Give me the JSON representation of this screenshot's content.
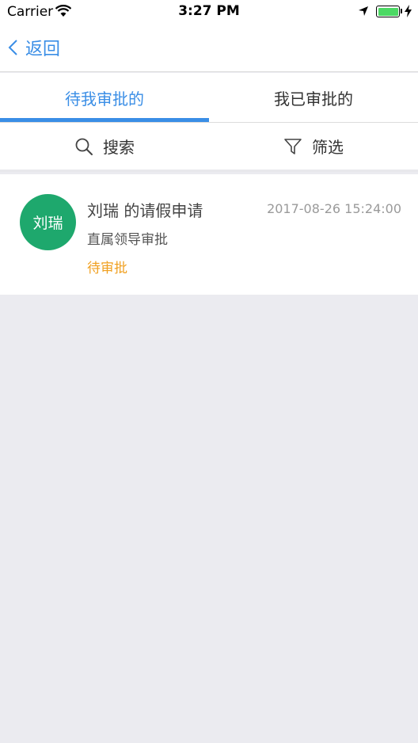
{
  "status_bar": {
    "carrier": "Carrier",
    "time": "3:27 PM",
    "icons": [
      "wifi-icon",
      "location-arrow-icon",
      "battery-icon",
      "charging-bolt-icon"
    ],
    "battery_color": "#4cd964"
  },
  "nav": {
    "back_label": "返回",
    "accent_color": "#3a8ee6"
  },
  "tabs": [
    {
      "label": "待我审批的",
      "active": true
    },
    {
      "label": "我已审批的",
      "active": false
    }
  ],
  "tools": {
    "search_label": "搜索",
    "filter_label": "筛选"
  },
  "list": {
    "items": [
      {
        "avatar_text": "刘瑞",
        "avatar_color": "#1ea86d",
        "title": "刘瑞 的请假申请",
        "time": "2017-08-26 15:24:00",
        "subtitle": "直属领导审批",
        "status": "待审批",
        "status_color": "#f0a020"
      }
    ]
  }
}
